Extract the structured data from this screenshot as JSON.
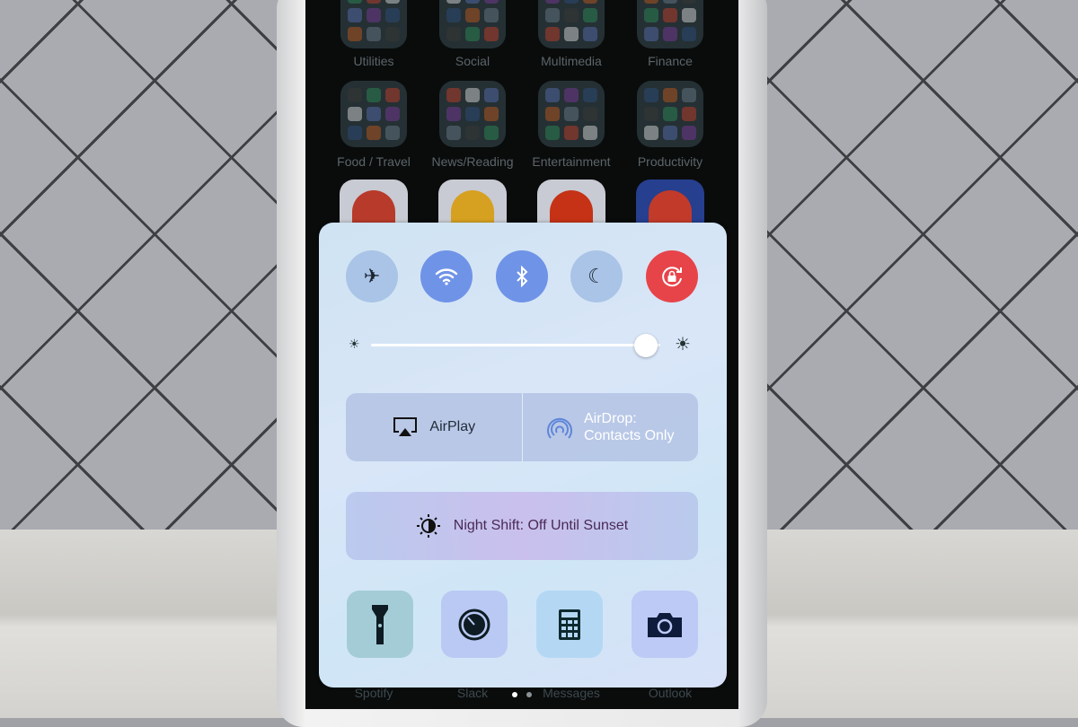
{
  "home_screen": {
    "folders": [
      {
        "label": "Utilities"
      },
      {
        "label": "Social"
      },
      {
        "label": "Multimedia"
      },
      {
        "label": "Finance"
      },
      {
        "label": "Food / Travel"
      },
      {
        "label": "News/Reading"
      },
      {
        "label": "Entertainment"
      },
      {
        "label": "Productivity"
      }
    ],
    "apps": [
      "chrome-icon",
      "google-photos-icon",
      "red-circle-app-icon",
      "pokemon-go-icon"
    ],
    "dock": [
      {
        "label": "Spotify"
      },
      {
        "label": "Slack"
      },
      {
        "label": "Messages"
      },
      {
        "label": "Outlook"
      }
    ],
    "page_dots": {
      "count": 2,
      "current": 1
    }
  },
  "control_center": {
    "toggles": [
      {
        "icon": "airplane-icon",
        "state": "off"
      },
      {
        "icon": "wifi-icon",
        "state": "on"
      },
      {
        "icon": "bluetooth-icon",
        "state": "on"
      },
      {
        "icon": "moon-icon",
        "state": "off"
      },
      {
        "icon": "rotation-lock-icon",
        "state": "on"
      }
    ],
    "brightness": 0.95,
    "airplay": {
      "label": "AirPlay"
    },
    "airdrop": {
      "label_line1": "AirDrop:",
      "label_line2": "Contacts Only"
    },
    "night_shift": {
      "label": "Night Shift: Off Until Sunset"
    },
    "shortcuts": [
      "flashlight-icon",
      "timer-icon",
      "calculator-icon",
      "camera-icon"
    ],
    "colors": {
      "toggle_on": "#6f93e7",
      "toggle_off": "#a9c4e6",
      "rotation_lock": "#e7444a"
    }
  }
}
